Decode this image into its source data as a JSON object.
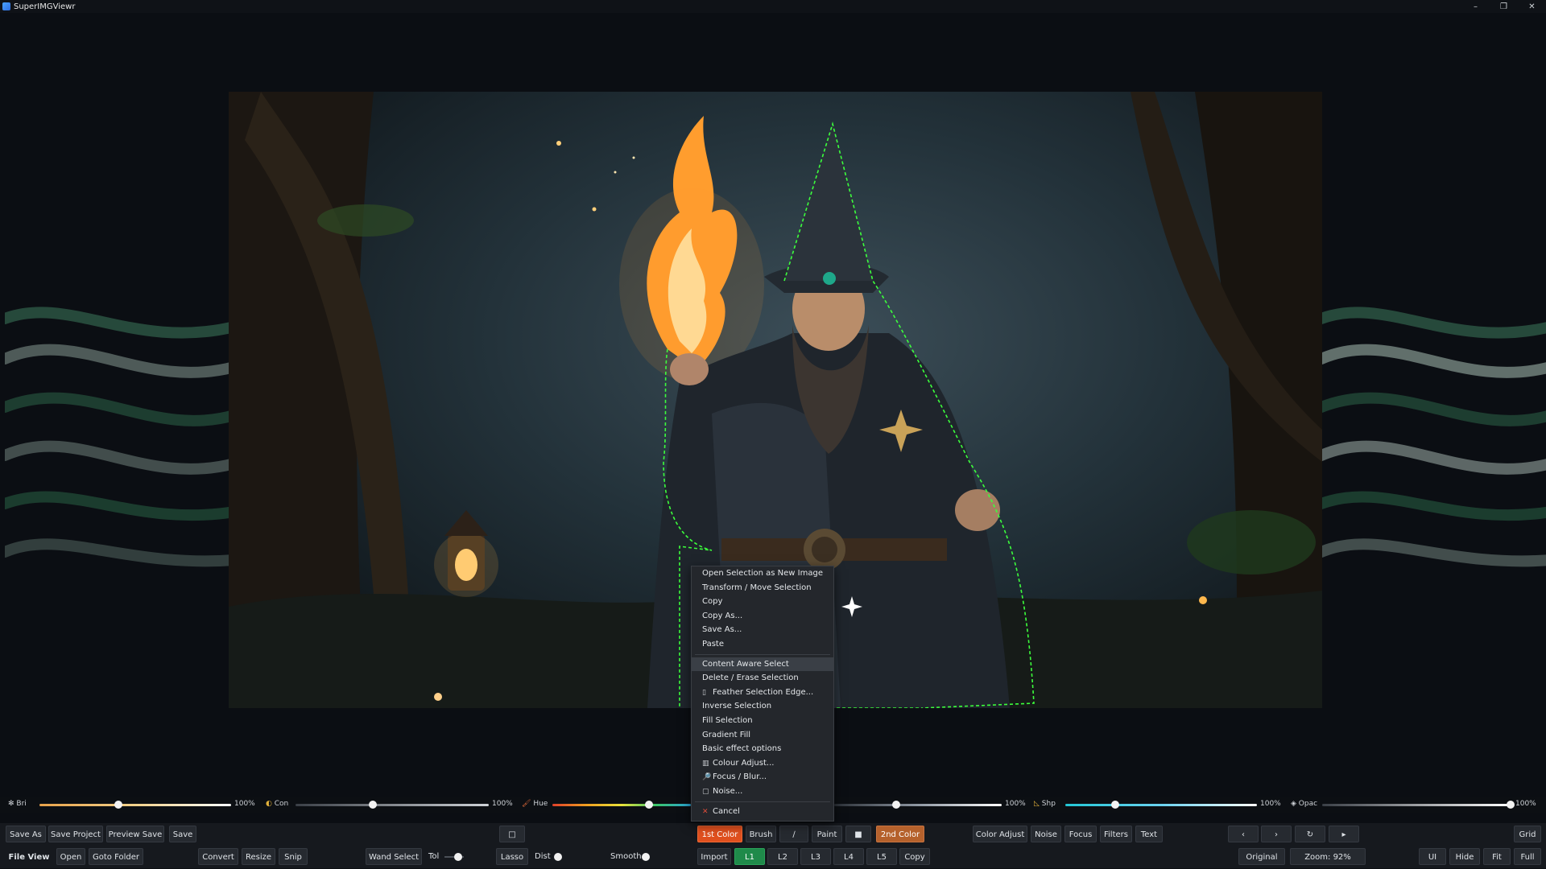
{
  "window": {
    "title": "SuperIMGViewr",
    "controls": {
      "minimize": "–",
      "maximize": "❐",
      "close": "✕"
    }
  },
  "context_menu": {
    "items": [
      {
        "label": "Open Selection as New Image"
      },
      {
        "label": "Transform / Move Selection"
      },
      {
        "label": "Copy"
      },
      {
        "label": "Copy As..."
      },
      {
        "label": "Save As..."
      },
      {
        "label": "Paste"
      },
      {
        "label": "Content Aware Select",
        "highlighted": true
      },
      {
        "label": "Delete / Erase Selection"
      },
      {
        "label": "Feather Selection Edge...",
        "icon": "▯"
      },
      {
        "label": "Inverse Selection"
      },
      {
        "label": "Fill Selection"
      },
      {
        "label": "Gradient Fill"
      },
      {
        "label": "Basic effect options"
      },
      {
        "label": "Colour Adjust...",
        "icon": "▥"
      },
      {
        "label": "Focus / Blur...",
        "icon": "🔎"
      },
      {
        "label": "Noise...",
        "icon": "▢"
      },
      {
        "label": "Cancel",
        "icon": "✕"
      }
    ]
  },
  "sliders": [
    {
      "name": "bri",
      "icon": "✻",
      "label": "Bri",
      "value": "100%",
      "level": 0.41
    },
    {
      "name": "con",
      "icon": "◐",
      "label": "Con",
      "value": "100%",
      "level": 0.4
    },
    {
      "name": "hue",
      "icon": "🖌",
      "label": "Hue",
      "value": "",
      "level": 0.7
    },
    {
      "name": "sat",
      "icon": "",
      "label": "",
      "value": "100%",
      "level": 0.37
    },
    {
      "name": "shp",
      "icon": "◺",
      "label": "Shp",
      "value": "100%",
      "level": 0.26
    },
    {
      "name": "opac",
      "icon": "◈",
      "label": "Opac",
      "value": "100%",
      "level": 1.0
    }
  ],
  "toolbar1": {
    "save_as": "Save As",
    "save_project": "Save Project",
    "preview_save": "Preview Save",
    "save": "Save",
    "rect": "□",
    "first_color": "1st Color",
    "brush": "Brush",
    "line": "∕",
    "paint": "Paint",
    "shape": "■",
    "second_color": "2nd Color",
    "color_adjust": "Color Adjust",
    "noise": "Noise",
    "focus": "Focus",
    "filters": "Filters",
    "text": "Text",
    "prev": "‹",
    "next": "›",
    "rotate": "↻",
    "play": "▸",
    "grid": "Grid"
  },
  "toolbar2": {
    "file_view": "File View",
    "open": "Open",
    "goto_folder": "Goto Folder",
    "convert": "Convert",
    "resize": "Resize",
    "snip": "Snip",
    "wand_select": "Wand Select",
    "tol": "Tol",
    "lasso": "Lasso",
    "dist": "Dist",
    "smooth": "Smooth",
    "import": "Import",
    "l1": "L1",
    "l2": "L2",
    "l3": "L3",
    "l4": "L4",
    "l5": "L5",
    "copy": "Copy",
    "original": "Original",
    "zoom": "Zoom: 92%",
    "ui": "UI",
    "hide": "Hide",
    "fit": "Fit",
    "full": "Full"
  },
  "colors": {
    "accent_orange": "#e0501f",
    "second_color": "#b5612c",
    "layer_active": "#1f8a4a",
    "selection": "#3cff3c"
  }
}
